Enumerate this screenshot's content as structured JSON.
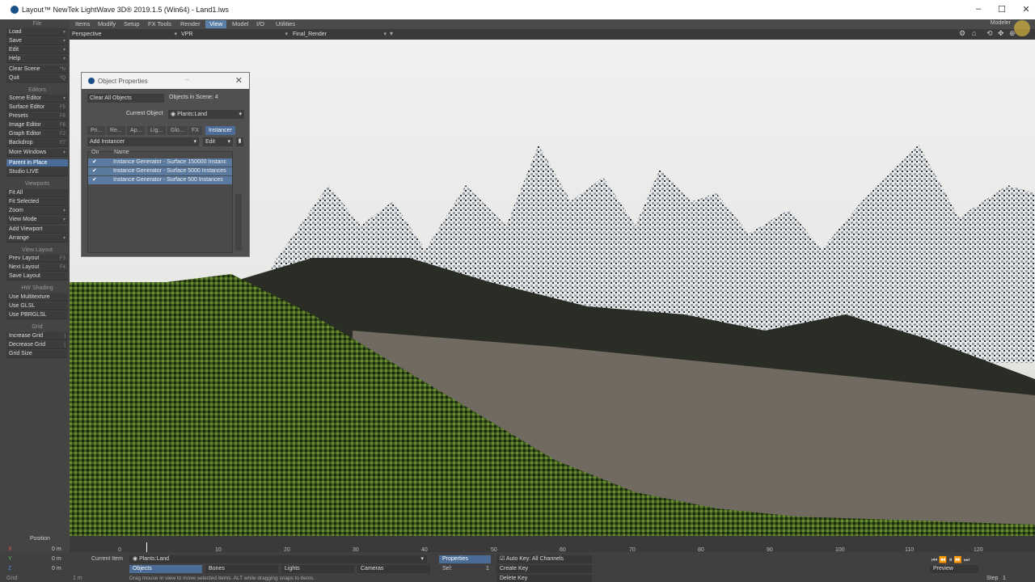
{
  "window": {
    "title": "Layout™ NewTek LightWave 3D® 2019.1.5 (Win64) - Land1.lws"
  },
  "menu": {
    "tabs": [
      "Items",
      "Modify",
      "Setup",
      "FX Tools",
      "Render",
      "View",
      "Model",
      "I/O",
      "Utilities"
    ],
    "active": "View",
    "modeler": "Modeler"
  },
  "toolrow": {
    "view_type": "Perspective",
    "render_mode": "VPR",
    "camera": "Final_Render"
  },
  "left": {
    "file_hdr": "File",
    "load": "Load",
    "save": "Save",
    "edit": "Edit",
    "help": "Help",
    "clear_scene": "Clear Scene",
    "clear_key": "^N",
    "quit": "Quit",
    "quit_key": "^Q",
    "editors_hdr": "Editors",
    "scene_editor": "Scene Editor",
    "surface_editor": "Surface Editor",
    "surface_key": "F5",
    "presets": "Presets",
    "presets_key": "F8",
    "image_editor": "Image Editor",
    "image_key": "F6",
    "graph_editor": "Graph Editor",
    "graph_key": "F2",
    "backdrop": "Backdrop",
    "backdrop_key": "F7",
    "more_windows": "More Windows",
    "parent_in_place": "Parent in Place",
    "studio_live": "Studio LIVE",
    "viewports_hdr": "Viewports",
    "fit_all": "Fit All",
    "fit_sel": "Fit Selected",
    "zoom": "Zoom",
    "view_mode": "View Mode",
    "add_viewport": "Add Viewport",
    "arrange": "Arrange",
    "view_layout_hdr": "View Layout",
    "prev_layout": "Prev Layout",
    "prev_key": "F3",
    "next_layout": "Next Layout",
    "next_key": "F4",
    "save_layout": "Save Layout",
    "hw_hdr": "HW Shading",
    "use_multi": "Use Multitexture",
    "use_glsl": "Use GLSL",
    "use_pbr": "Use PBRGLSL",
    "grid_hdr": "Grid",
    "inc_grid": "Increase Grid",
    "inc_key": "]",
    "dec_grid": "Decrease Grid",
    "dec_key": "[",
    "grid_size": "Grid Size"
  },
  "objprops": {
    "title": "Object Properties",
    "clear_all": "Clear All Objects",
    "objects_in_scene": "Objects in Scene: 4",
    "current_object_label": "Current Object",
    "current_object": "Plants:Land",
    "tabs": [
      "Pri...",
      "Re...",
      "Ap...",
      "Lig...",
      "Glo...",
      "FX",
      "Instancer"
    ],
    "add_instancer": "Add Instancer",
    "edit": "Edit",
    "col_on": "On",
    "col_name": "Name",
    "rows": [
      "Instance Generator - Surface 150000 Instanc",
      "Instance Generator - Surface 5000 Instances",
      "Instance Generator - Surface 500 Instances"
    ]
  },
  "timeline": {
    "ticks": [
      "0",
      "10",
      "20",
      "30",
      "40",
      "50",
      "60",
      "70",
      "80",
      "90",
      "100",
      "110",
      "120"
    ]
  },
  "bottom": {
    "position": "Position",
    "x": "X",
    "y": "Y",
    "z": "Z",
    "x_val": "0 m",
    "y_val": "0 m",
    "z_val": "0 m",
    "current_item_label": "Current Item",
    "current_item": "Plants:Land",
    "objects": "Objects",
    "bones": "Bones",
    "lights": "Lights",
    "cameras": "Cameras",
    "properties": "Properties",
    "sel": "Sel:",
    "sel_val": "1",
    "auto_key": "Auto Key: All Channels",
    "create_key": "Create Key",
    "delete_key": "Delete Key",
    "hint": "Drag mouse in view to move selected items. ALT while dragging snaps to items.",
    "preview": "Preview",
    "step": "Step",
    "step_val": "1",
    "grid": "Grid",
    "grid_val": "1 m"
  }
}
